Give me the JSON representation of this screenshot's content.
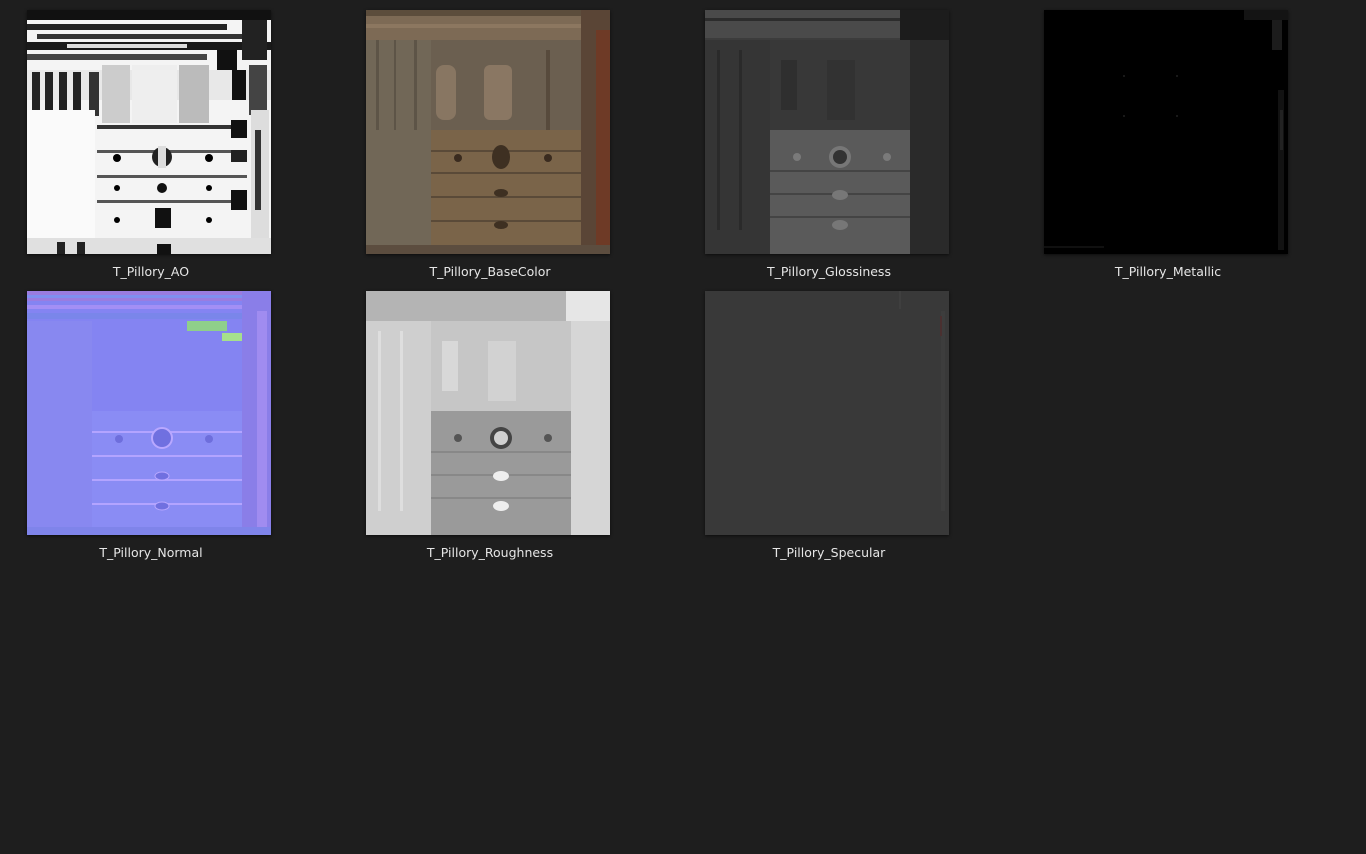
{
  "files": [
    {
      "name": "T_Pillory_AO",
      "kind": "ao"
    },
    {
      "name": "T_Pillory_BaseColor",
      "kind": "basecolor"
    },
    {
      "name": "T_Pillory_Glossiness",
      "kind": "glossiness"
    },
    {
      "name": "T_Pillory_Metallic",
      "kind": "metallic"
    },
    {
      "name": "T_Pillory_Normal",
      "kind": "normal"
    },
    {
      "name": "T_Pillory_Roughness",
      "kind": "roughness"
    },
    {
      "name": "T_Pillory_Specular",
      "kind": "specular"
    }
  ],
  "colors": {
    "background": "#1e1e1e",
    "caption": "#e6e6e6"
  }
}
